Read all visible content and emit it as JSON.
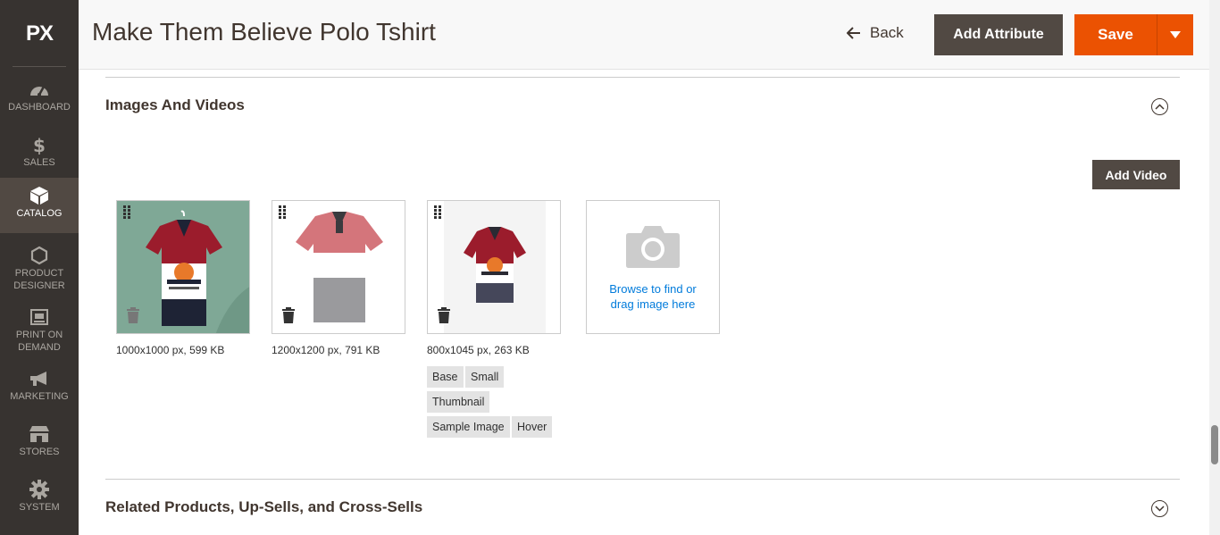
{
  "app": {
    "logo": "PX"
  },
  "sidebar": {
    "items": [
      {
        "label": "DASHBOARD",
        "icon": "dashboard-icon"
      },
      {
        "label": "SALES",
        "icon": "dollar-icon"
      },
      {
        "label": "CATALOG",
        "icon": "box-icon",
        "active": true
      },
      {
        "label": "PRODUCT DESIGNER",
        "icon": "hexagon-icon"
      },
      {
        "label": "PRINT ON DEMAND",
        "icon": "print-icon"
      },
      {
        "label": "MARKETING",
        "icon": "megaphone-icon"
      },
      {
        "label": "STORES",
        "icon": "store-icon"
      },
      {
        "label": "SYSTEM",
        "icon": "gear-icon"
      }
    ]
  },
  "header": {
    "title": "Make Them Believe Polo Tshirt",
    "back_label": "Back",
    "add_attribute_label": "Add Attribute",
    "save_label": "Save"
  },
  "images_section": {
    "title": "Images And Videos",
    "add_video_label": "Add Video",
    "images": [
      {
        "info": "1000x1000 px, 599 KB",
        "roles": []
      },
      {
        "info": "1200x1200 px, 791 KB",
        "roles": []
      },
      {
        "info": "800x1045 px, 263 KB",
        "roles": [
          "Base",
          "Small",
          "Thumbnail",
          "Sample Image",
          "Hover"
        ]
      }
    ],
    "upload_text_line1": "Browse to find or",
    "upload_text_line2": "drag image here"
  },
  "related_section": {
    "title": "Related Products, Up-Sells, and Cross-Sells"
  },
  "colors": {
    "sidebar_bg": "#373330",
    "sidebar_active": "#514943",
    "accent": "#eb5202",
    "dark_button": "#514943",
    "link": "#007bdb"
  }
}
